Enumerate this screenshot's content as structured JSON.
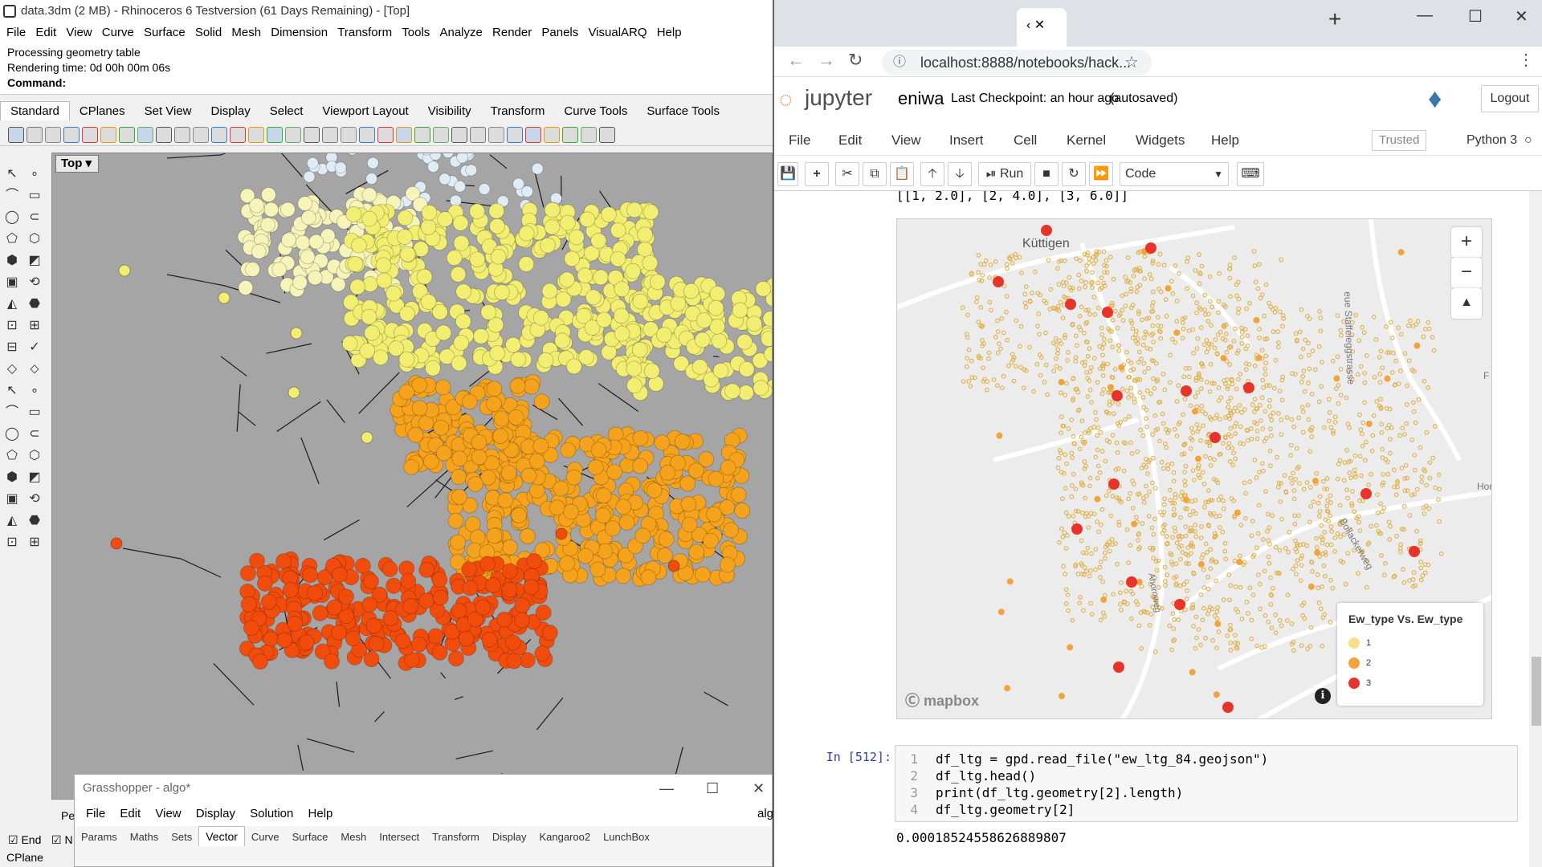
{
  "rhino": {
    "title": "data.3dm (2 MB) - Rhinoceros 6 Testversion (61 Days Remaining) - [Top]",
    "menu": [
      "File",
      "Edit",
      "View",
      "Curve",
      "Surface",
      "Solid",
      "Mesh",
      "Dimension",
      "Transform",
      "Tools",
      "Analyze",
      "Render",
      "Panels",
      "VisualARQ",
      "Help"
    ],
    "command_history": [
      "Processing geometry table",
      "Rendering time: 0d 00h 00m 06s"
    ],
    "command_label": "Command:",
    "toolbar_tabs": [
      "Standard",
      "CPlanes",
      "Set View",
      "Display",
      "Select",
      "Viewport Layout",
      "Visibility",
      "Transform",
      "Curve Tools",
      "Surface Tools"
    ],
    "viewport_label": "Top",
    "status": {
      "end_label": "End",
      "cplane_label": "CPlane",
      "pe_label": "Pe",
      "n_label": "N"
    },
    "cluster_colors": {
      "light": "#e0ecf5",
      "pale": "#f6f4b8",
      "yellow": "#f2ee72",
      "orange": "#f5a21c",
      "red": "#f24c0c"
    }
  },
  "grasshopper": {
    "title": "Grasshopper - algo*",
    "menu": [
      "File",
      "Edit",
      "View",
      "Display",
      "Solution",
      "Help"
    ],
    "doc": "algo",
    "tabs": [
      "Params",
      "Maths",
      "Sets",
      "Vector",
      "Curve",
      "Surface",
      "Mesh",
      "Intersect",
      "Transform",
      "Display",
      "Kangaroo2",
      "LunchBox"
    ],
    "active_tab": "Vector"
  },
  "browser": {
    "url": "localhost:8888/notebooks/hack...",
    "active_tab_label": "‹ ✕"
  },
  "jupyter": {
    "logo": "jupyter",
    "notebook_name": "eniwa",
    "checkpoint": "Last Checkpoint: an hour ago",
    "autosaved": "(autosaved)",
    "logout": "Logout",
    "menu": [
      "File",
      "Edit",
      "View",
      "Insert",
      "Cell",
      "Kernel",
      "Widgets",
      "Help"
    ],
    "trusted": "Trusted",
    "kernel": "Python 3",
    "run_label": "Run",
    "cell_type": "Code",
    "output_prev": "[[1, 2.0], [2, 4.0], [3, 6.0]]",
    "cell_prompt": "In [512]:",
    "code_lines": [
      "df_ltg = gpd.read_file(\"ew_ltg_84.geojson\")",
      "df_ltg.head()",
      "print(df_ltg.geometry[2].length)",
      "df_ltg.geometry[2]"
    ],
    "line_numbers": [
      "1",
      "2",
      "3",
      "4"
    ],
    "output_value": "0.00018524558626889807"
  },
  "map": {
    "place_label": "Küttigen",
    "street_1": "eue Staffeleggstrasse",
    "street_2": "Bollackerweg",
    "street_3": "Ahornweg",
    "street_4": "Hor",
    "street_5": "F",
    "attribution": "mapbox",
    "zoom_in": "+",
    "zoom_out": "−",
    "compass": "▲",
    "info": "i",
    "legend_title": "Ew_type Vs. Ew_type",
    "legend_items": [
      {
        "label": "1",
        "color": "#f7df8c"
      },
      {
        "label": "2",
        "color": "#f2a33c"
      },
      {
        "label": "3",
        "color": "#e8332a"
      }
    ]
  }
}
